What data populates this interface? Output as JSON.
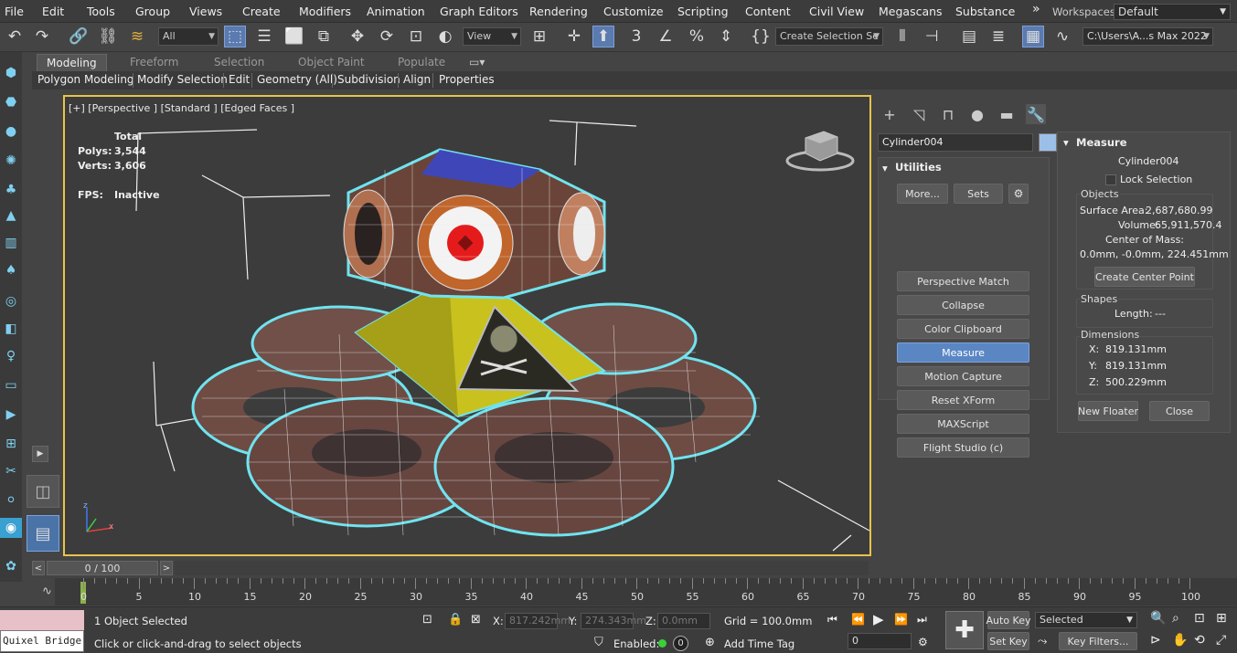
{
  "menu": {
    "items": [
      "File",
      "Edit",
      "Tools",
      "Group",
      "Views",
      "Create",
      "Modifiers",
      "Animation",
      "Graph Editors",
      "Rendering",
      "Customize",
      "Scripting",
      "Content",
      "Civil View",
      "Megascans",
      "Substance"
    ],
    "overflow": "»",
    "workspaces_label": "Workspaces:",
    "workspace_value": "Default"
  },
  "toolbar": {
    "selection_filter": "All",
    "ref_coord": "View",
    "named_selection": "Create Selection Se",
    "project_path": "C:\\Users\\A...s Max 2022"
  },
  "ribbon": {
    "tabs": [
      "Modeling",
      "Freeform",
      "Selection",
      "Object Paint",
      "Populate"
    ],
    "sub_items": [
      "Polygon Modeling",
      "Modify Selection",
      "Edit",
      "Geometry (All)",
      "Subdivision",
      "Align",
      "Properties"
    ]
  },
  "viewport": {
    "label": "[+] [Perspective ] [Standard ] [Edged Faces ]",
    "stats": {
      "total_label": "Total",
      "polys_label": "Polys:",
      "polys_value": "3,544",
      "verts_label": "Verts:",
      "verts_value": "3,606",
      "fps_label": "FPS:",
      "fps_value": "Inactive"
    },
    "axis_labels": {
      "z": "z",
      "x": "x"
    }
  },
  "command_panel": {
    "object_name": "Cylinder004",
    "object_color": "#9cbfe8",
    "utilities": {
      "title": "Utilities",
      "more_button": "More...",
      "sets_button": "Sets",
      "buttons": [
        "Perspective Match",
        "Collapse",
        "Color Clipboard",
        "Measure",
        "Motion Capture",
        "Reset XForm",
        "MAXScript",
        "Flight Studio (c)"
      ],
      "active": "Measure"
    },
    "measure": {
      "title": "Measure",
      "object": "Cylinder004",
      "lock_selection": "Lock Selection",
      "objects_group": "Objects",
      "surface_area_label": "Surface Area:",
      "surface_area_value": "2,687,680.99",
      "volume_label": "Volume:",
      "volume_value": "65,911,570.4",
      "center_of_mass_label": "Center of Mass:",
      "center_of_mass_value": "0.0mm, -0.0mm, 224.451mm",
      "create_center_point": "Create Center Point",
      "shapes_group": "Shapes",
      "length_label": "Length:",
      "length_value": "---",
      "dimensions_group": "Dimensions",
      "dim_x_label": "X:",
      "dim_x_value": "819.131mm",
      "dim_y_label": "Y:",
      "dim_y_value": "819.131mm",
      "dim_z_label": "Z:",
      "dim_z_value": "500.229mm",
      "new_floater": "New Floater",
      "close": "Close"
    }
  },
  "timeline": {
    "frame_display": "0 / 100",
    "prev": "<",
    "next": ">",
    "ticks": [
      "0",
      "5",
      "10",
      "15",
      "20",
      "25",
      "30",
      "35",
      "40",
      "45",
      "50",
      "55",
      "60",
      "65",
      "70",
      "75",
      "80",
      "85",
      "90",
      "95",
      "100"
    ]
  },
  "status": {
    "quixel": "Quixel Bridge",
    "selected": "1 Object Selected",
    "prompt": "Click or click-and-drag to select objects",
    "x_label": "X:",
    "x_value": "817.242mm",
    "y_label": "Y:",
    "y_value": "274.343mm",
    "z_label": "Z:",
    "z_value": "0.0mm",
    "grid": "Grid = 100.0mm",
    "enabled_label": "Enabled:",
    "enabled_value": "0",
    "add_time_tag": "Add Time Tag",
    "auto_key": "Auto Key",
    "set_key": "Set Key",
    "key_mode": "Selected",
    "key_filters": "Key Filters...",
    "frame_value": "0"
  }
}
